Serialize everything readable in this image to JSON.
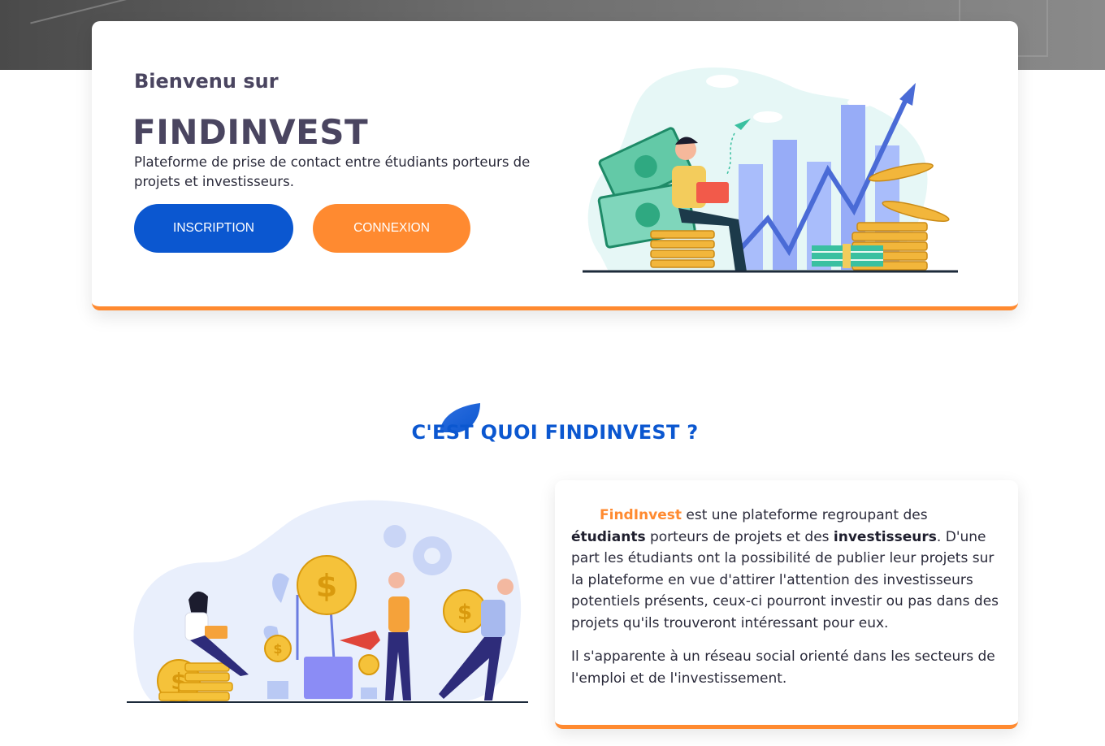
{
  "hero": {
    "welcome": "Bienvenu sur",
    "brand": "FINDINVEST",
    "tagline": "Plateforme de prise de contact entre étudiants porteurs de projets et investisseurs.",
    "signup_label": "INSCRIPTION",
    "login_label": "CONNEXION"
  },
  "section": {
    "title": "C'EST QUOI FINDINVEST ?"
  },
  "about": {
    "p1": {
      "brand": "FindInvest",
      "t1": " est une plateforme regroupant des ",
      "b1": "étudiants",
      "t2": " porteurs de projets et des ",
      "b2": "investisseurs",
      "t3": ". D'une part les étudiants ont la possibilité de publier leur projets sur la plateforme en vue d'attirer l'attention des investisseurs potentiels présents, ceux-ci pourront investir ou pas dans des projets qu'ils trouveront intéressant pour eux."
    },
    "p2": "Il s'apparente à un réseau social orienté dans les secteurs de l'emploi et de l'investissement."
  },
  "colors": {
    "primary": "#0b57d0",
    "accent": "#ff8a30",
    "heading": "#4a4560"
  },
  "icons": [
    "growth-chart-illustration",
    "leaf-icon",
    "money-plants-illustration"
  ]
}
